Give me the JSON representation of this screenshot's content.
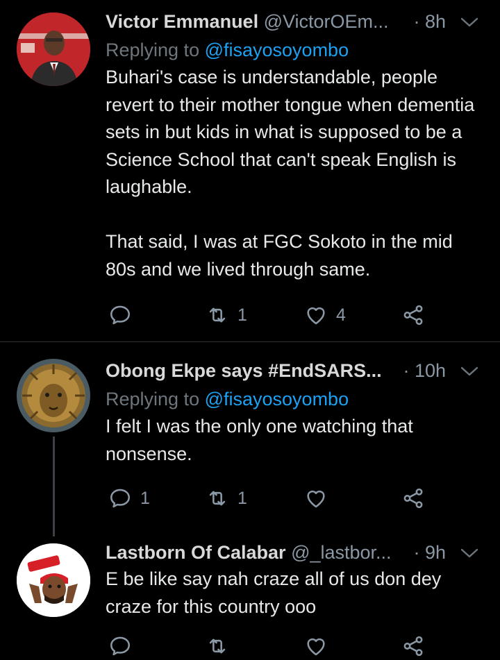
{
  "tweets": [
    {
      "name": "Victor Emmanuel",
      "handle": "@VictorOEm...",
      "time": "· 8h",
      "replying_prefix": "Replying to ",
      "replying_to": "@fisayosoyombo",
      "text": "Buhari's case is understandable, people revert to their mother tongue when dementia sets in but kids in what is supposed to be a Science School that can't speak English is laughable.\n\nThat said, I was at FGC Sokoto in the mid 80s and we lived through same.",
      "replies": "",
      "retweets": "1",
      "likes": "4"
    },
    {
      "name": "Obong Ekpe says #EndSARS...",
      "handle": "",
      "time": "· 10h",
      "replying_prefix": "Replying to ",
      "replying_to": "@fisayosoyombo",
      "text": "I felt I was the only one watching that nonsense.",
      "replies": "1",
      "retweets": "1",
      "likes": ""
    },
    {
      "name": "Lastborn Of Calabar",
      "handle": "@_lastbor...",
      "time": "· 9h",
      "text": "E be like say nah craze all of us don dey craze for this country ooo",
      "replies": "",
      "retweets": "",
      "likes": ""
    }
  ],
  "icons": {
    "reply": "reply-icon",
    "retweet": "retweet-icon",
    "like": "heart-icon",
    "share": "share-icon",
    "more": "chevron-down-icon"
  },
  "colors": {
    "background": "#000000",
    "mention": "#1da1f2",
    "secondary_text": "#8b98a5",
    "divider": "#2f3336"
  }
}
